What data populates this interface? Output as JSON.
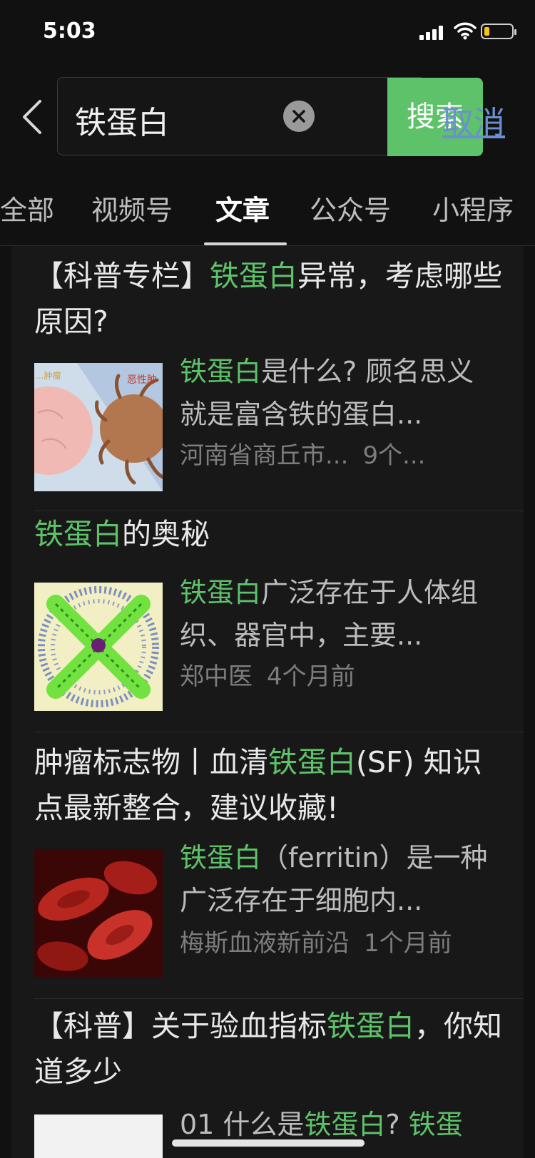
{
  "status": {
    "time": "5:03"
  },
  "search": {
    "back_icon": "chevron-left-icon",
    "query": "铁蛋白",
    "search_label": "搜索",
    "cancel_label": "取消"
  },
  "tabs": [
    {
      "label": "全部"
    },
    {
      "label": "视频号"
    },
    {
      "label": "文章"
    },
    {
      "label": "公众号"
    },
    {
      "label": "小程序"
    }
  ],
  "active_tab": "文章",
  "accent_color": "#5ec26a",
  "articles": [
    {
      "title_parts": [
        "【科普专栏】",
        "铁蛋白",
        "异常，考虑哪些原因?"
      ],
      "snippet_parts": [
        "铁蛋白",
        "是什么? 顾名思义就是富含铁的蛋白..."
      ],
      "source": "河南省商丘市...",
      "time": "9个...",
      "thumb_text": [
        "...肿瘤",
        "恶性肿"
      ]
    },
    {
      "title_parts": [
        "",
        "铁蛋白",
        "的奥秘"
      ],
      "snippet_parts": [
        "铁蛋白",
        "广泛存在于人体组织、器官中，主要..."
      ],
      "source": "郑中医",
      "time": "4个月前"
    },
    {
      "title_parts": [
        "肿瘤标志物丨血清",
        "铁蛋白",
        "(SF) 知识点最新整合，建议收藏!"
      ],
      "snippet_parts": [
        "铁蛋白",
        "（ferritin）是一种广泛存在于细胞内..."
      ],
      "source": "梅斯血液新前沿",
      "time": "1个月前"
    },
    {
      "title_parts": [
        "【科普】关于验血指标",
        "铁蛋白",
        "，你知道多少"
      ],
      "snippet_parts": [
        "01 什么是",
        "铁蛋白",
        "? ",
        "铁蛋"
      ]
    }
  ]
}
